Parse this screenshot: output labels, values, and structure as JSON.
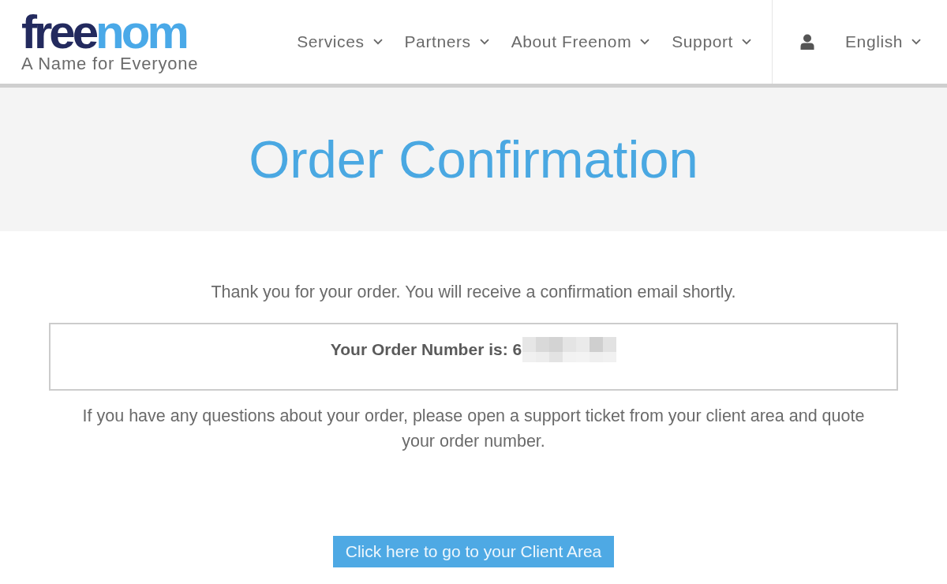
{
  "logo": {
    "first": "free",
    "second": "nom",
    "tagline": "A Name for Everyone"
  },
  "nav": {
    "items": [
      {
        "label": "Services"
      },
      {
        "label": "Partners"
      },
      {
        "label": "About Freenom"
      },
      {
        "label": "Support"
      }
    ]
  },
  "account": {
    "language": "English"
  },
  "banner": {
    "title": "Order Confirmation"
  },
  "message": "Thank you for your order. You will receive a confirmation email shortly.",
  "order_box": {
    "label": "Your Order Number is: 6"
  },
  "note": "If you have any questions about your order, please open a support ticket from your client area and quote your order number.",
  "button": "Click here to go to your Client Area"
}
